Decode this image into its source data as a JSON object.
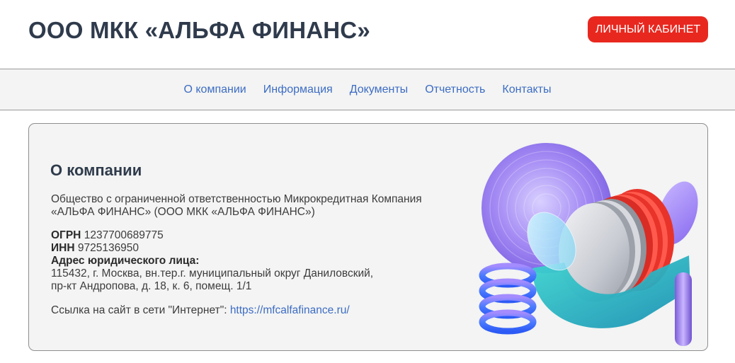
{
  "header": {
    "title": "ООО МКК «АЛЬФА ФИНАНС»",
    "cabinet_button": "ЛИЧНЫЙ КАБИНЕТ"
  },
  "nav": {
    "items": [
      {
        "label": "О компании"
      },
      {
        "label": "Информация"
      },
      {
        "label": "Документы"
      },
      {
        "label": "Отчетность"
      },
      {
        "label": "Контакты"
      }
    ]
  },
  "about": {
    "heading": "О компании",
    "description_line1": "Общество с ограниченной ответственностью Микрокредитная Компания",
    "description_line2": "«АЛЬФА ФИНАНС» (ООО МКК «АЛЬФА ФИНАНС»)",
    "ogrn_label": "ОГРН",
    "ogrn_value": "1237700689775",
    "inn_label": "ИНН",
    "inn_value": "9725136950",
    "address_label": "Адрес юридического лица:",
    "address_line1": "115432, г. Москва, вн.тер.г. муниципальный округ Даниловский,",
    "address_line2": "пр-кт Андропова, д. 18, к. 6, помещ. 1/1",
    "site_label": "Ссылка на сайт в сети \"Интернет\":",
    "site_url": "https://mfcalfafinance.ru/"
  },
  "colors": {
    "accent_red": "#e8281f",
    "link_blue": "#3d6cc4",
    "title_dark": "#2f3b4c"
  }
}
